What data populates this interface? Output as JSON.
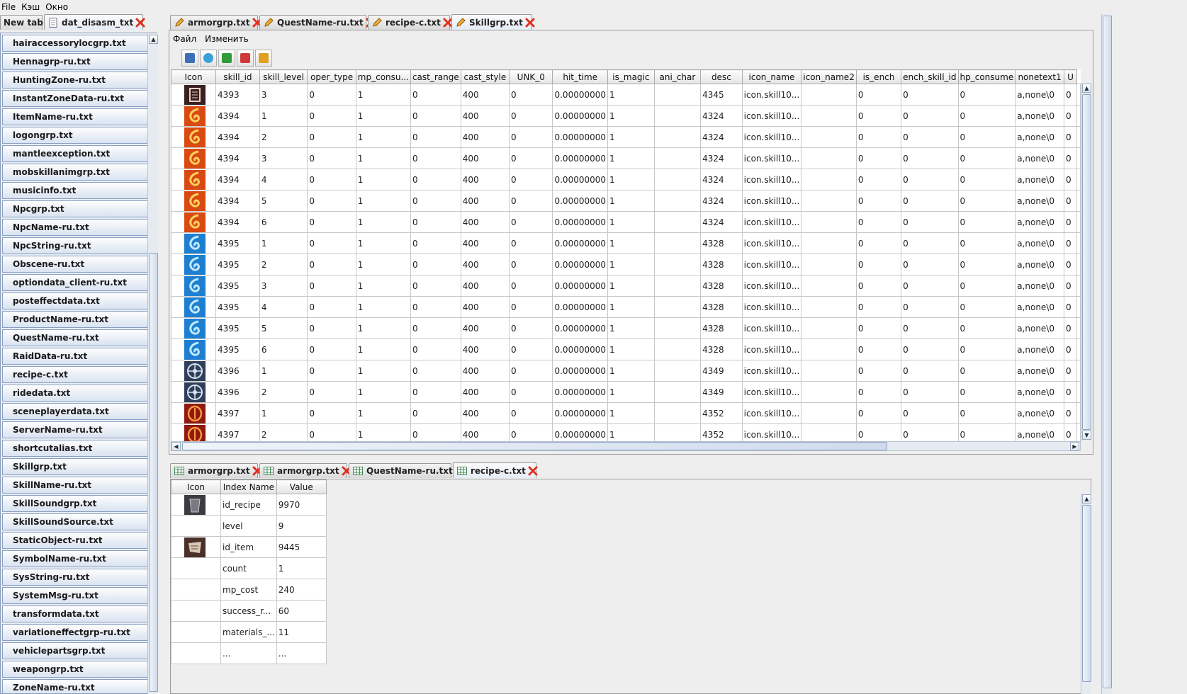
{
  "menubar": {
    "file": "File",
    "cache": "Кэш",
    "window": "Окно"
  },
  "left": {
    "tabs": [
      {
        "label": "New tab"
      },
      {
        "label": "dat_disasm_txt"
      }
    ],
    "files": [
      "hairaccessorylocgrp.txt",
      "Hennagrp-ru.txt",
      "HuntingZone-ru.txt",
      "InstantZoneData-ru.txt",
      "ItemName-ru.txt",
      "logongrp.txt",
      "mantleexception.txt",
      "mobskillanimgrp.txt",
      "musicinfo.txt",
      "Npcgrp.txt",
      "NpcName-ru.txt",
      "NpcString-ru.txt",
      "Obscene-ru.txt",
      "optiondata_client-ru.txt",
      "posteffectdata.txt",
      "ProductName-ru.txt",
      "QuestName-ru.txt",
      "RaidData-ru.txt",
      "recipe-c.txt",
      "ridedata.txt",
      "sceneplayerdata.txt",
      "ServerName-ru.txt",
      "shortcutalias.txt",
      "Skillgrp.txt",
      "SkillName-ru.txt",
      "SkillSoundgrp.txt",
      "SkillSoundSource.txt",
      "StaticObject-ru.txt",
      "SymbolName-ru.txt",
      "SysString-ru.txt",
      "SystemMsg-ru.txt",
      "transformdata.txt",
      "variationeffectgrp-ru.txt",
      "vehiclepartsgrp.txt",
      "weapongrp.txt",
      "ZoneName-ru.txt"
    ]
  },
  "editor": {
    "tabs": [
      {
        "label": "armorgrp.txt"
      },
      {
        "label": "QuestName-ru.txt"
      },
      {
        "label": "recipe-c.txt"
      },
      {
        "label": "Skillgrp.txt"
      }
    ],
    "menu": {
      "file": "Файл",
      "edit": "Изменить"
    },
    "columns": [
      "Icon",
      "skill_id",
      "skill_level",
      "oper_type",
      "mp_consu...",
      "cast_range",
      "cast_style",
      "UNK_0",
      "hit_time",
      "is_magic",
      "ani_char",
      "desc",
      "icon_name",
      "icon_name2",
      "is_ench",
      "ench_skill_id",
      "hp_consume",
      "nonetext1",
      "U"
    ],
    "rows": [
      {
        "icon": "skill-icon-4393",
        "c": [
          "4393",
          "3",
          "0",
          "1",
          "0",
          "400",
          "0",
          "0.00000000",
          "1",
          "",
          "4345",
          "icon.skill10...",
          "",
          "0",
          "0",
          "0",
          "a,none\\0",
          "0"
        ]
      },
      {
        "icon": "skill-icon-fire",
        "c": [
          "4394",
          "1",
          "0",
          "1",
          "0",
          "400",
          "0",
          "0.00000000",
          "1",
          "",
          "4324",
          "icon.skill10...",
          "",
          "0",
          "0",
          "0",
          "a,none\\0",
          "0"
        ]
      },
      {
        "icon": "skill-icon-fire",
        "c": [
          "4394",
          "2",
          "0",
          "1",
          "0",
          "400",
          "0",
          "0.00000000",
          "1",
          "",
          "4324",
          "icon.skill10...",
          "",
          "0",
          "0",
          "0",
          "a,none\\0",
          "0"
        ]
      },
      {
        "icon": "skill-icon-fire",
        "c": [
          "4394",
          "3",
          "0",
          "1",
          "0",
          "400",
          "0",
          "0.00000000",
          "1",
          "",
          "4324",
          "icon.skill10...",
          "",
          "0",
          "0",
          "0",
          "a,none\\0",
          "0"
        ]
      },
      {
        "icon": "skill-icon-fire",
        "c": [
          "4394",
          "4",
          "0",
          "1",
          "0",
          "400",
          "0",
          "0.00000000",
          "1",
          "",
          "4324",
          "icon.skill10...",
          "",
          "0",
          "0",
          "0",
          "a,none\\0",
          "0"
        ]
      },
      {
        "icon": "skill-icon-fire",
        "c": [
          "4394",
          "5",
          "0",
          "1",
          "0",
          "400",
          "0",
          "0.00000000",
          "1",
          "",
          "4324",
          "icon.skill10...",
          "",
          "0",
          "0",
          "0",
          "a,none\\0",
          "0"
        ]
      },
      {
        "icon": "skill-icon-fire",
        "c": [
          "4394",
          "6",
          "0",
          "1",
          "0",
          "400",
          "0",
          "0.00000000",
          "1",
          "",
          "4324",
          "icon.skill10...",
          "",
          "0",
          "0",
          "0",
          "a,none\\0",
          "0"
        ]
      },
      {
        "icon": "skill-icon-water",
        "c": [
          "4395",
          "1",
          "0",
          "1",
          "0",
          "400",
          "0",
          "0.00000000",
          "1",
          "",
          "4328",
          "icon.skill10...",
          "",
          "0",
          "0",
          "0",
          "a,none\\0",
          "0"
        ]
      },
      {
        "icon": "skill-icon-water",
        "c": [
          "4395",
          "2",
          "0",
          "1",
          "0",
          "400",
          "0",
          "0.00000000",
          "1",
          "",
          "4328",
          "icon.skill10...",
          "",
          "0",
          "0",
          "0",
          "a,none\\0",
          "0"
        ]
      },
      {
        "icon": "skill-icon-water",
        "c": [
          "4395",
          "3",
          "0",
          "1",
          "0",
          "400",
          "0",
          "0.00000000",
          "1",
          "",
          "4328",
          "icon.skill10...",
          "",
          "0",
          "0",
          "0",
          "a,none\\0",
          "0"
        ]
      },
      {
        "icon": "skill-icon-water",
        "c": [
          "4395",
          "4",
          "0",
          "1",
          "0",
          "400",
          "0",
          "0.00000000",
          "1",
          "",
          "4328",
          "icon.skill10...",
          "",
          "0",
          "0",
          "0",
          "a,none\\0",
          "0"
        ]
      },
      {
        "icon": "skill-icon-water",
        "c": [
          "4395",
          "5",
          "0",
          "1",
          "0",
          "400",
          "0",
          "0.00000000",
          "1",
          "",
          "4328",
          "icon.skill10...",
          "",
          "0",
          "0",
          "0",
          "a,none\\0",
          "0"
        ]
      },
      {
        "icon": "skill-icon-water",
        "c": [
          "4395",
          "6",
          "0",
          "1",
          "0",
          "400",
          "0",
          "0.00000000",
          "1",
          "",
          "4328",
          "icon.skill10...",
          "",
          "0",
          "0",
          "0",
          "a,none\\0",
          "0"
        ]
      },
      {
        "icon": "skill-icon-wind",
        "c": [
          "4396",
          "1",
          "0",
          "1",
          "0",
          "400",
          "0",
          "0.00000000",
          "1",
          "",
          "4349",
          "icon.skill10...",
          "",
          "0",
          "0",
          "0",
          "a,none\\0",
          "0"
        ]
      },
      {
        "icon": "skill-icon-wind",
        "c": [
          "4396",
          "2",
          "0",
          "1",
          "0",
          "400",
          "0",
          "0.00000000",
          "1",
          "",
          "4349",
          "icon.skill10...",
          "",
          "0",
          "0",
          "0",
          "a,none\\0",
          "0"
        ]
      },
      {
        "icon": "skill-icon-earth",
        "c": [
          "4397",
          "1",
          "0",
          "1",
          "0",
          "400",
          "0",
          "0.00000000",
          "1",
          "",
          "4352",
          "icon.skill10...",
          "",
          "0",
          "0",
          "0",
          "a,none\\0",
          "0"
        ]
      },
      {
        "icon": "skill-icon-earth",
        "c": [
          "4397",
          "2",
          "0",
          "1",
          "0",
          "400",
          "0",
          "0.00000000",
          "1",
          "",
          "4352",
          "icon.skill10...",
          "",
          "0",
          "0",
          "0",
          "a,none\\0",
          "0"
        ]
      }
    ]
  },
  "bottom": {
    "tabs": [
      {
        "label": "armorgrp.txt"
      },
      {
        "label": "armorgrp.txt"
      },
      {
        "label": "QuestName-ru.txt"
      },
      {
        "label": "recipe-c.txt"
      }
    ],
    "columns": [
      "Icon",
      "Index Name",
      "Value"
    ],
    "rows": [
      {
        "icon": "recipe-icon",
        "name": "id_recipe",
        "value": "9970"
      },
      {
        "icon": "",
        "name": "level",
        "value": "9"
      },
      {
        "icon": "item-icon",
        "name": "id_item",
        "value": "9445"
      },
      {
        "icon": "",
        "name": "count",
        "value": "1"
      },
      {
        "icon": "",
        "name": "mp_cost",
        "value": "240"
      },
      {
        "icon": "",
        "name": "success_r...",
        "value": "60"
      },
      {
        "icon": "",
        "name": "materials_...",
        "value": "11"
      },
      {
        "icon": "",
        "name": "...",
        "value": "..."
      }
    ]
  },
  "colors": {
    "fire": "#d94a12",
    "water": "#1e7fd0",
    "wind": "#2f3f5a",
    "earth": "#8e1a10",
    "accent": "#e0301e"
  }
}
